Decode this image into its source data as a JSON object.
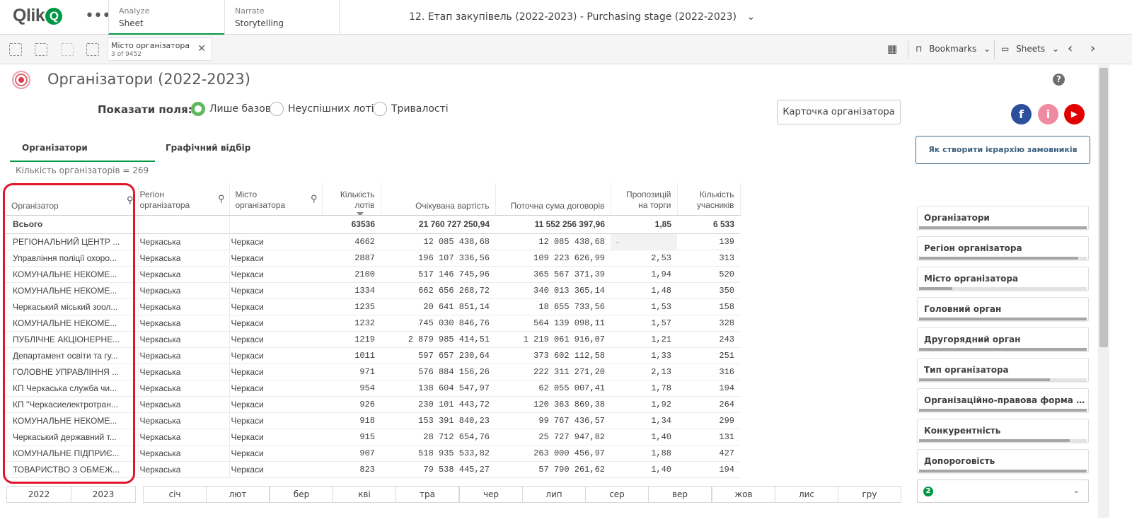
{
  "app": {
    "logo": "Qlik",
    "tabs": [
      {
        "top": "Analyze",
        "bottom": "Sheet"
      },
      {
        "top": "Narrate",
        "bottom": "Storytelling"
      }
    ],
    "title": "12. Етап закупівель (2022-2023) - Purchasing stage (2022-2023)"
  },
  "toolbar": {
    "selection": {
      "field": "Місто організатора",
      "state": "3 of 9452"
    },
    "bookmarks": "Bookmarks",
    "sheets": "Sheets"
  },
  "sheet": {
    "title": "Організатори (2022-2023)",
    "show_fields_label": "Показати поля:",
    "radios": [
      {
        "label": "Лише базові",
        "checked": true
      },
      {
        "label": "Неуспішних лотів",
        "checked": false
      },
      {
        "label": "Тривалості",
        "checked": false
      }
    ],
    "card_button": "Карточка організатора",
    "hierarchy_button": "Як створити ієрархію замовників",
    "subtabs": [
      "Організатори",
      "Графічний відбір"
    ],
    "count_text": "Кількість організаторів = 269"
  },
  "table": {
    "headers": [
      "Організатор",
      "Регіон організатора",
      "Місто організатора",
      "Кількість лотів",
      "Очікувана вартість",
      "Поточна сума договорів",
      "Пропозицій на торги",
      "Кількість учасників"
    ],
    "total": [
      "Всього",
      "",
      "",
      "63536",
      "21 760 727 250,94",
      "11 552 256 397,96",
      "1,85",
      "6 533"
    ],
    "rows": [
      [
        "РЕГІОНАЛЬНИЙ ЦЕНТР ...",
        "Черкаська",
        "Черкаси",
        "4662",
        "12 085 438,68",
        "12 085 438,68",
        "-",
        "139"
      ],
      [
        "Управління поліції охоро...",
        "Черкаська",
        "Черкаси",
        "2887",
        "196 107 336,56",
        "109 223 626,99",
        "2,53",
        "313"
      ],
      [
        "КОМУНАЛЬНЕ НЕКОМЕ...",
        "Черкаська",
        "Черкаси",
        "2100",
        "517 146 745,96",
        "365 567 371,39",
        "1,94",
        "520"
      ],
      [
        "КОМУНАЛЬНЕ НЕКОМЕ...",
        "Черкаська",
        "Черкаси",
        "1334",
        "662 656 268,72",
        "340 013 365,14",
        "1,48",
        "350"
      ],
      [
        "Черкаський міський зоол...",
        "Черкаська",
        "Черкаси",
        "1235",
        "20 641 851,14",
        "18 655 733,56",
        "1,53",
        "158"
      ],
      [
        "КОМУНАЛЬНЕ НЕКОМЕ...",
        "Черкаська",
        "Черкаси",
        "1232",
        "745 030 846,76",
        "564 139 098,11",
        "1,57",
        "328"
      ],
      [
        "ПУБЛІЧНЕ АКЦІОНЕРНЕ...",
        "Черкаська",
        "Черкаси",
        "1219",
        "2 879 985 414,51",
        "1 219 061 916,07",
        "1,21",
        "243"
      ],
      [
        "Департамент освіти та гу...",
        "Черкаська",
        "Черкаси",
        "1011",
        "597 657 230,64",
        "373 602 112,58",
        "1,33",
        "251"
      ],
      [
        "ГОЛОВНЕ УПРАВЛІННЯ ...",
        "Черкаська",
        "Черкаси",
        "971",
        "576 884 156,26",
        "222 311 271,20",
        "2,13",
        "316"
      ],
      [
        "КП Черкаська служба чи...",
        "Черкаська",
        "Черкаси",
        "954",
        "138 604 547,97",
        "62 055 007,41",
        "1,78",
        "194"
      ],
      [
        "КП \"Черкасиелектротран...",
        "Черкаська",
        "Черкаси",
        "926",
        "230 101 443,72",
        "120 363 869,38",
        "1,92",
        "264"
      ],
      [
        "КОМУНАЛЬНЕ НЕКОМЕ...",
        "Черкаська",
        "Черкаси",
        "918",
        "153 391 840,23",
        "99 767 436,57",
        "1,34",
        "299"
      ],
      [
        "Черкаський державний т...",
        "Черкаська",
        "Черкаси",
        "915",
        "28 712 654,76",
        "25 727 947,82",
        "1,40",
        "131"
      ],
      [
        "КОМУНАЛЬНЕ ПІДПРИЄ...",
        "Черкаська",
        "Черкаси",
        "907",
        "518 935 533,82",
        "263 000 456,97",
        "1,88",
        "427"
      ],
      [
        "ТОВАРИСТВО З ОБМЕЖ...",
        "Черкаська",
        "Черкаси",
        "823",
        "79 538 445,27",
        "57 790 261,62",
        "1,40",
        "194"
      ]
    ]
  },
  "filters": [
    {
      "label": "Організатори",
      "fill": 1.0
    },
    {
      "label": "Регіон організатора",
      "fill": 0.95
    },
    {
      "label": "Місто організатора",
      "fill": 0.2
    },
    {
      "label": "Головний орган",
      "fill": 1.0
    },
    {
      "label": "Другорядний орган",
      "fill": 1.0
    },
    {
      "label": "Тип організатора",
      "fill": 0.78
    },
    {
      "label": "Організаційно-правова форма орг...",
      "fill": 1.0
    },
    {
      "label": "Конкурентність",
      "fill": 0.9
    },
    {
      "label": "Допороговість",
      "fill": 1.0
    }
  ],
  "years": [
    "2022",
    "2023"
  ],
  "months": [
    "січ",
    "лют",
    "бер",
    "кві",
    "тра",
    "чер",
    "лип",
    "сер",
    "вер",
    "жов",
    "лис",
    "гру"
  ],
  "dropdown_badge": "2"
}
